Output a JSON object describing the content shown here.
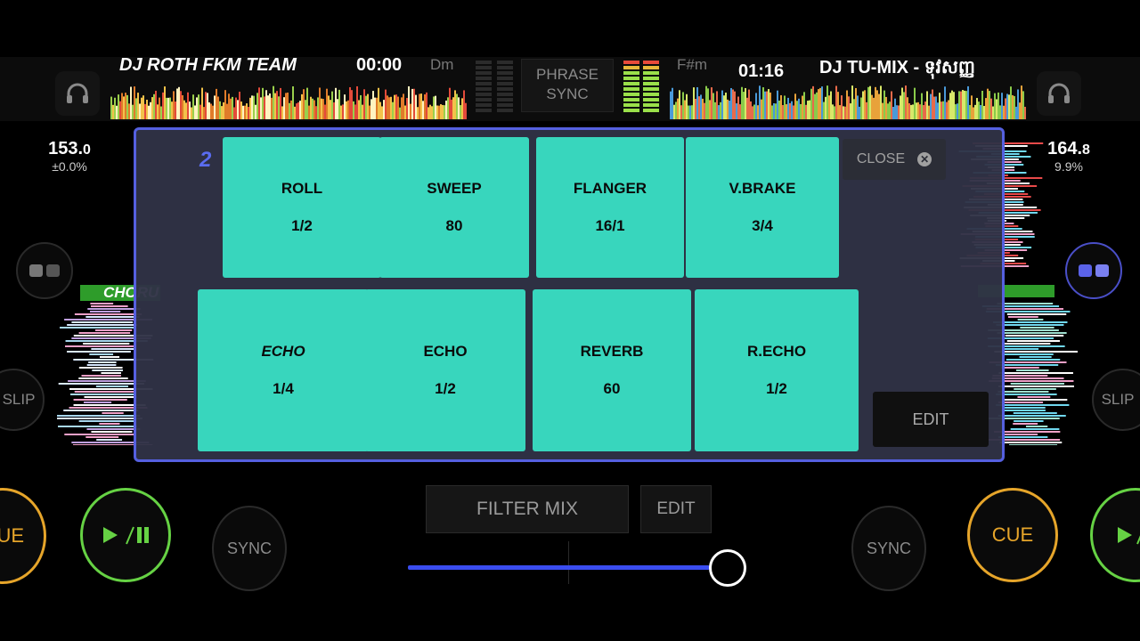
{
  "deck_left": {
    "title": "DJ ROTH FKM TEAM",
    "time": "00:00",
    "key": "Dm",
    "bpm_main": "153.",
    "bpm_dec": "0",
    "pitch": "±0.0%",
    "hot_cue_label": "CHORU",
    "slip": "SLIP",
    "cue": "UE",
    "sync": "SYNC"
  },
  "deck_right": {
    "title": "DJ TU-MIX  -  ទុវសញ្ញ",
    "time": "01:16",
    "key": "F#m",
    "bpm_main": "164.",
    "bpm_dec": "8",
    "pitch": "9.9%",
    "slip": "SLIP",
    "cue": "CUE",
    "sync": "SYNC"
  },
  "phrase_sync": {
    "line1": "PHRASE",
    "line2": "SYNC"
  },
  "fx_panel": {
    "deck_number": "2",
    "close_label": "CLOSE",
    "edit_label": "EDIT",
    "pads": [
      {
        "name": "ROLL",
        "value": "1/2"
      },
      {
        "name": "SWEEP",
        "value": "80"
      },
      {
        "name": "FLANGER",
        "value": "16/1"
      },
      {
        "name": "V.BRAKE",
        "value": "3/4"
      },
      {
        "name": "ECHO",
        "value": "1/4"
      },
      {
        "name": "ECHO",
        "value": "1/2"
      },
      {
        "name": "REVERB",
        "value": "60"
      },
      {
        "name": "R.ECHO",
        "value": "1/2"
      }
    ]
  },
  "filter": {
    "mix_label": "FILTER MIX",
    "edit_label": "EDIT",
    "crossfader_level": 0.96
  },
  "colors": {
    "pad": "#38d6bd",
    "panel_border": "#5560e0",
    "cue": "#e6a52a",
    "play": "#66d244",
    "fader": "#3a4df0"
  },
  "icons": {
    "play_pause": "play-pause-icon",
    "headphones": "headphones-icon",
    "close": "close-icon"
  }
}
